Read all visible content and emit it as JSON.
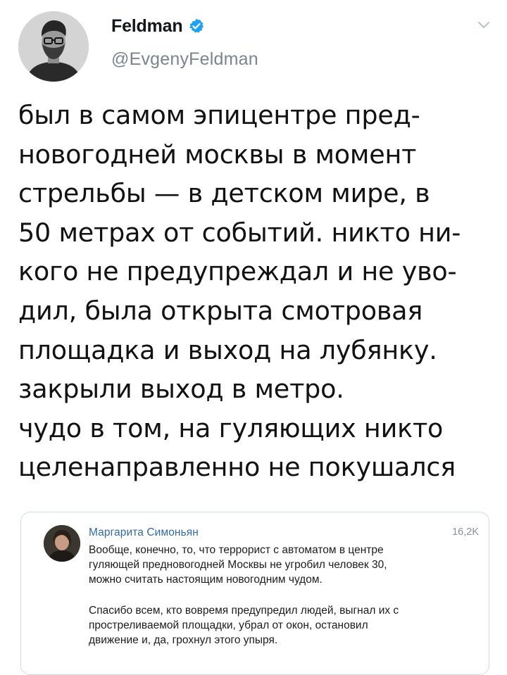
{
  "tweet": {
    "display_name": "Feldman",
    "handle": "@EvgenyFeldman",
    "icons": {
      "verified": "verified-badge-icon",
      "menu": "chevron-down-icon"
    },
    "colors": {
      "verified": "#1da1f2",
      "handle": "#7a8590",
      "text": "#121212"
    },
    "text_lines": [
      "был в самом эпицентре пред-",
      "новогодней москвы в момент",
      "стрельбы — в детском мире, в",
      "50 метрах от событий. никто ни-",
      "кого не предупреждал и не уво-",
      "дил, была открыта смотровая",
      "площадка и выход на лубянку.",
      "закрыли выход в метро.",
      "чудо в том, на гуляющих никто",
      "целенаправленно не покушался"
    ]
  },
  "embedded_post": {
    "author": "Маргарита Симоньян",
    "count": "16,2K",
    "colors": {
      "author": "#2f6aa3",
      "border": "#d3dbe2"
    },
    "paragraph_1": [
      "Вообще, конечно, то, что террорист с автоматом в центре",
      "гуляющей предновогодней Москвы не угробил человек 30,",
      "можно считать настоящим новогодним чудом."
    ],
    "paragraph_2": [
      "Спасибо всем, кто вовремя предупредил людей, выгнал их с",
      "простреливаемой площадки, убрал от окон, остановил",
      "движение и, да, грохнул этого упыря."
    ]
  }
}
